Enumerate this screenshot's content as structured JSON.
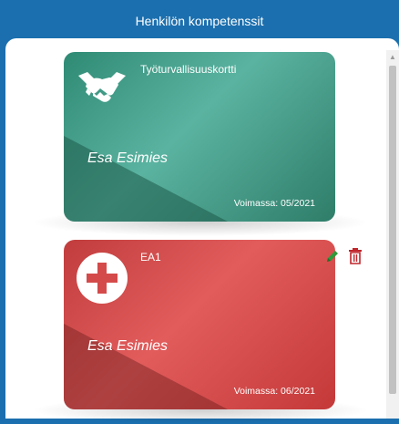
{
  "header": {
    "title": "Henkilön kompetenssit"
  },
  "cards": [
    {
      "title": "Työturvallisuuskortti",
      "name": "Esa Esimies",
      "valid_label": "Voimassa: 05/2021",
      "icon": "handshake-icon",
      "color": "#3a9480"
    },
    {
      "title": "EA1",
      "name": "Esa Esimies",
      "valid_label": "Voimassa: 06/2021",
      "icon": "medical-cross-icon",
      "color": "#d44a4a"
    }
  ],
  "actions": {
    "edit_icon": "pencil-icon",
    "delete_icon": "trash-icon",
    "edit_color": "#2f9a3a",
    "delete_color": "#c0272d"
  }
}
